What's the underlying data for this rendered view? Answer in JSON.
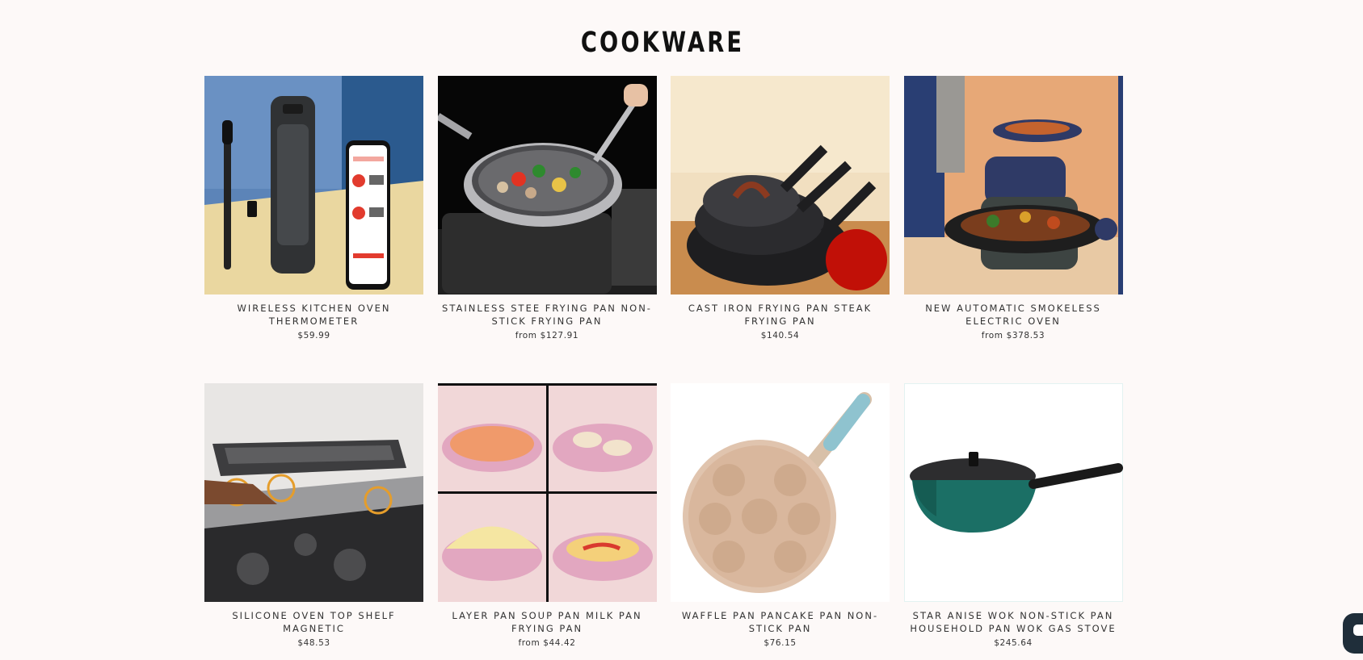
{
  "collection": {
    "title": "COOKWARE"
  },
  "products": [
    {
      "title": "WIRELESS KITCHEN OVEN THERMOMETER",
      "price": "$59.99",
      "image_icon": "meat-thermometer-image"
    },
    {
      "title": "STAINLESS STEE FRYING PAN NON-STICK FRYING PAN",
      "price": "from $127.91",
      "image_icon": "stainless-frying-pan-image"
    },
    {
      "title": "CAST IRON FRYING PAN STEAK FRYING PAN",
      "price": "$140.54",
      "image_icon": "cast-iron-pan-image"
    },
    {
      "title": "NEW AUTOMATIC SMOKELESS ELECTRIC OVEN",
      "price": "from $378.53",
      "image_icon": "electric-grill-image"
    },
    {
      "title": "SILICONE OVEN TOP SHELF MAGNETIC",
      "price": "$48.53",
      "image_icon": "oven-shelf-image"
    },
    {
      "title": "LAYER PAN SOUP PAN MILK PAN FRYING PAN",
      "price": "from $44.42",
      "image_icon": "pink-pan-collage-image"
    },
    {
      "title": "WAFFLE PAN PANCAKE PAN NON-STICK PAN",
      "price": "$76.15",
      "image_icon": "pancake-pan-image"
    },
    {
      "title": "STAR ANISE WOK NON-STICK PAN HOUSEHOLD PAN WOK GAS STOVE",
      "price": "$245.64",
      "image_icon": "green-wok-image"
    }
  ],
  "chat": {
    "icon": "chat-icon",
    "color": "#1f2e3a"
  }
}
